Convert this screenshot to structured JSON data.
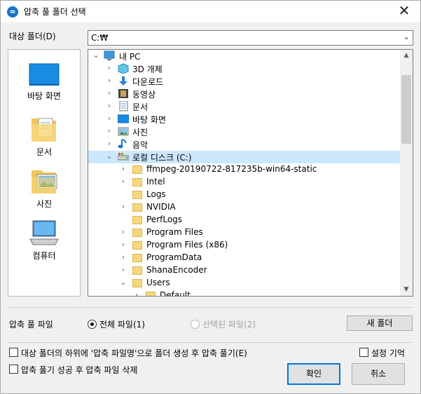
{
  "window": {
    "title": "압축 풀 폴더 선택",
    "close": "✕"
  },
  "target": {
    "label": "대상 폴더(D)",
    "value": "C:₩"
  },
  "places": [
    {
      "label": "바탕 화면"
    },
    {
      "label": "문서"
    },
    {
      "label": "사진"
    },
    {
      "label": "컴퓨터"
    }
  ],
  "tree": {
    "items": [
      {
        "label": "내 PC",
        "expander": "⌄"
      },
      {
        "label": "3D 개체",
        "expander": "›"
      },
      {
        "label": "다운로드",
        "expander": "›"
      },
      {
        "label": "동영상",
        "expander": "›"
      },
      {
        "label": "문서",
        "expander": "›"
      },
      {
        "label": "바탕 화면",
        "expander": "›"
      },
      {
        "label": "사진",
        "expander": "›"
      },
      {
        "label": "음악",
        "expander": "›"
      },
      {
        "label": "로컬 디스크 (C:)",
        "expander": "⌄"
      },
      {
        "label": "ffmpeg-20190722-817235b-win64-static",
        "expander": "›"
      },
      {
        "label": "Intel",
        "expander": "›"
      },
      {
        "label": "Logs",
        "expander": ""
      },
      {
        "label": "NVIDIA",
        "expander": "›"
      },
      {
        "label": "PerfLogs",
        "expander": ""
      },
      {
        "label": "Program Files",
        "expander": "›"
      },
      {
        "label": "Program Files (x86)",
        "expander": "›"
      },
      {
        "label": "ProgramData",
        "expander": "›"
      },
      {
        "label": "ShanaEncoder",
        "expander": "›"
      },
      {
        "label": "Users",
        "expander": "⌄"
      },
      {
        "label": "Default",
        "expander": "›"
      }
    ]
  },
  "options": {
    "files_label": "압축 풀 파일",
    "radio_all": "전체 파일(1)",
    "radio_selected": "선택된 파일(2)",
    "new_folder": "새 폴더",
    "check_subfolder": "대상 폴더의 하위에 '압축 파일명'으로 폴더 생성 후 압축 풀기(E)",
    "check_delete": "압축 풀기 성공 후 압축 파일 삭제",
    "check_remember": "설정 기억"
  },
  "buttons": {
    "ok": "확인",
    "cancel": "취소"
  }
}
